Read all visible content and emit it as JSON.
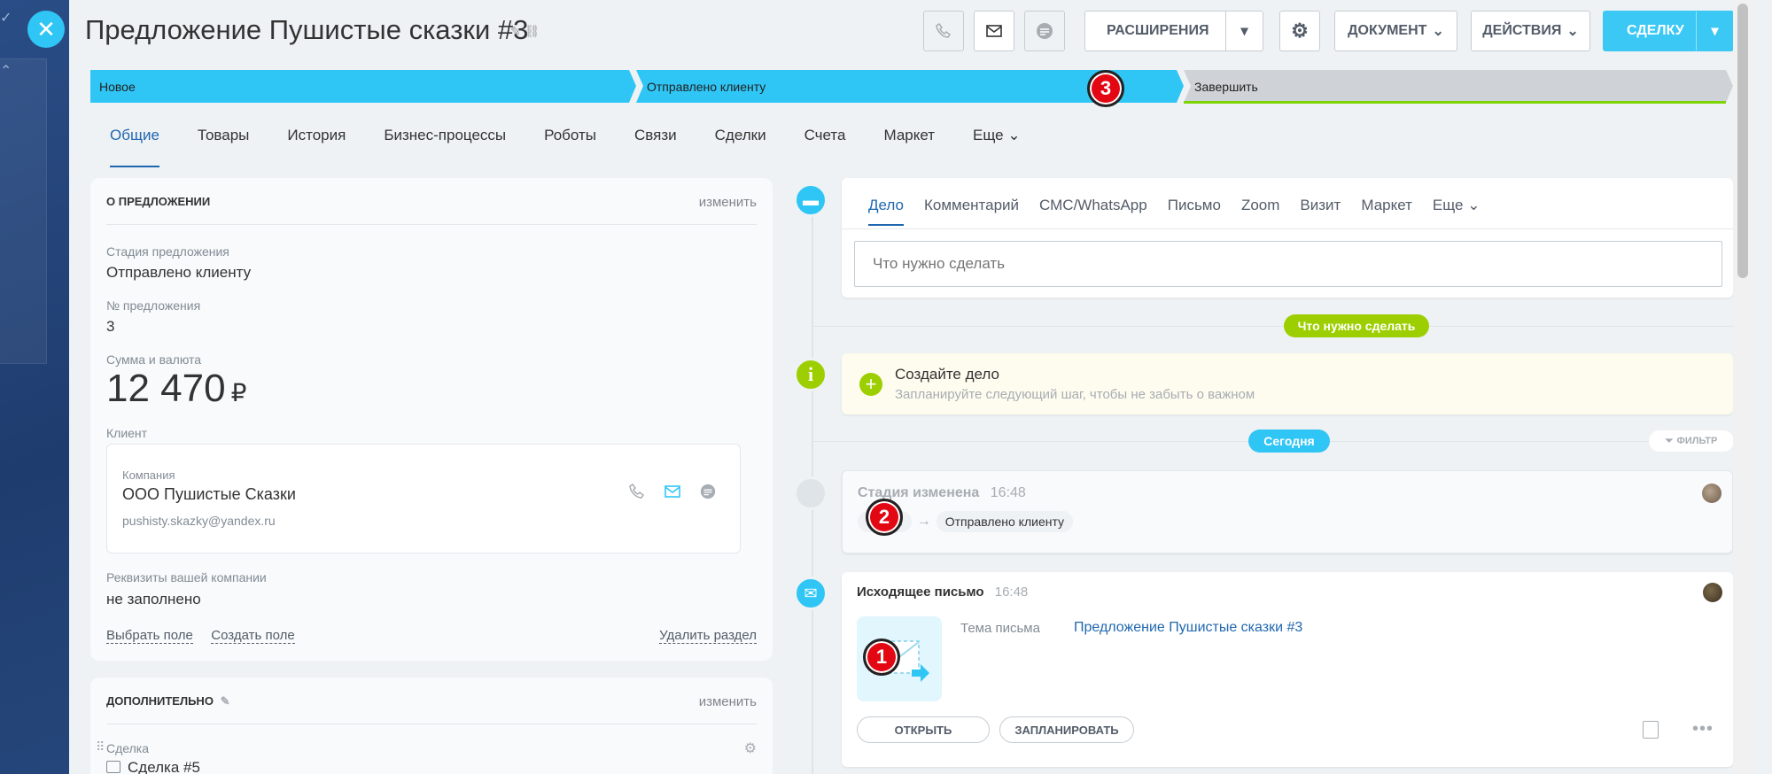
{
  "title": "Предложение Пушистые сказки #3",
  "header": {
    "extensions_label": "РАСШИРЕНИЯ",
    "document_label": "ДОКУМЕНТ",
    "actions_label": "ДЕЙСТВИЯ",
    "deal_label": "СДЕЛКУ"
  },
  "stages": [
    {
      "label": "Новое",
      "color": "#2fc6f6"
    },
    {
      "label": "Отправлено клиенту",
      "color": "#2fc6f6"
    },
    {
      "label": "Завершить",
      "color": "#cfd2d6"
    }
  ],
  "tabs": [
    "Общие",
    "Товары",
    "История",
    "Бизнес-процессы",
    "Роботы",
    "Связи",
    "Сделки",
    "Счета",
    "Маркет",
    "Еще"
  ],
  "about": {
    "heading": "О ПРЕДЛОЖЕНИИ",
    "edit": "изменить",
    "stage_label": "Стадия предложения",
    "stage_value": "Отправлено клиенту",
    "number_label": "№ предложения",
    "number_value": "3",
    "sum_label": "Сумма и валюта",
    "sum_value": "12 470",
    "currency": "₽",
    "client_label": "Клиент",
    "company_label": "Компания",
    "company_name": "ООО Пушистые Сказки",
    "company_email": "pushisty.skazky@yandex.ru",
    "requisites_label": "Реквизиты вашей компании",
    "requisites_value": "не заполнено",
    "choose_field": "Выбрать поле",
    "create_field": "Создать поле",
    "delete_section": "Удалить раздел"
  },
  "additional": {
    "heading": "ДОПОЛНИТЕЛЬНО",
    "edit": "изменить",
    "deal_label": "Сделка",
    "deal_value": "Сделка #5"
  },
  "composer": {
    "tabs": [
      "Дело",
      "Комментарий",
      "СМС/WhatsApp",
      "Письмо",
      "Zoom",
      "Визит",
      "Маркет",
      "Еще"
    ],
    "placeholder": "Что нужно сделать"
  },
  "timeline": {
    "todo_pill": "Что нужно сделать",
    "create_title": "Создайте дело",
    "create_sub": "Запланируйте следующий шаг, чтобы не забыть о важном",
    "today_pill": "Сегодня",
    "filter": "ФИЛЬТР",
    "stage_changed_title": "Стадия изменена",
    "stage_changed_time": "16:48",
    "stage_from": "Новое",
    "stage_to": "Отправлено клиенту",
    "email_title": "Исходящее письмо",
    "email_time": "16:48",
    "email_subject_label": "Тема письма",
    "email_subject": "Предложение Пушистые сказки #3",
    "open_btn": "ОТКРЫТЬ",
    "plan_btn": "ЗАПЛАНИРОВАТЬ"
  },
  "badges": [
    "1",
    "2",
    "3"
  ],
  "colors": {
    "accent": "#2fc6f6",
    "green": "#9dcf00",
    "link": "#2067b0",
    "badge": "#e30713"
  }
}
